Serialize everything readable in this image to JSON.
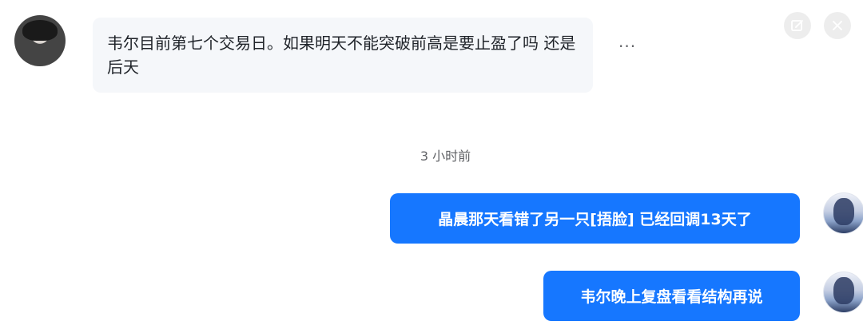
{
  "messages": [
    {
      "sender": "other",
      "text": "韦尔目前第七个交易日。如果明天不能突破前高是要止盈了吗 还是后天"
    },
    {
      "sender": "self",
      "text": "晶晨那天看错了另一只[捂脸] 已经回调13天了"
    },
    {
      "sender": "self",
      "text": "韦尔晚上复盘看看结构再说"
    }
  ],
  "timestamp": "3 小时前",
  "more_label": "···",
  "colors": {
    "accent": "#1677ff",
    "incoming_bubble": "#f5f7fa",
    "timestamp_text": "#606266"
  },
  "icons": [
    "edit-icon",
    "close-icon",
    "more-icon"
  ]
}
